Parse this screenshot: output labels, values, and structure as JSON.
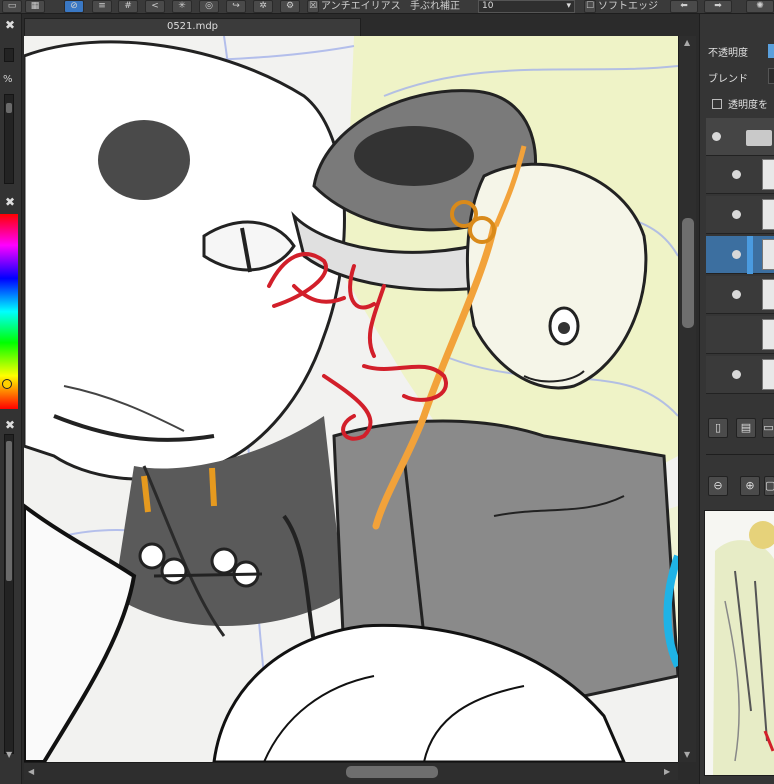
{
  "document": {
    "tab_title": "0521.mdp"
  },
  "toolbar": {
    "antialias_label": "アンチエイリアス",
    "stabilizer_label": "手ぶれ補正",
    "stabilizer_value": "10",
    "soft_edge_label": "ソフトエッジ"
  },
  "left_panel": {
    "percent_label": "%",
    "close_glyph": "✖"
  },
  "layer_panel": {
    "opacity_label": "不透明度",
    "blend_label": "ブレンド",
    "protect_alpha_label": "透明度を"
  },
  "colors": {
    "canvas_bg": "#f2f2f0",
    "ink_red": "#d21f2a",
    "ink_orange": "#f2a23a",
    "accent_blue": "#3c8fd6",
    "highlight_yellow": "#eaf2b4",
    "sketch_blue": "#9aaae6"
  },
  "icons": [
    "undo-icon",
    "redo-icon",
    "close-icon",
    "folder-icon",
    "eye-icon",
    "new-layer-icon",
    "zoom-in-icon",
    "zoom-out-icon"
  ]
}
